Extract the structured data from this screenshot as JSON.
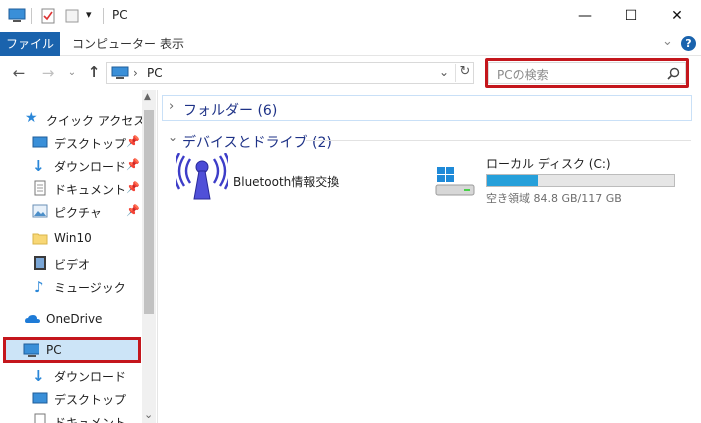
{
  "window": {
    "title": "PC",
    "minimize_glyph": "—",
    "maximize_glyph": "☐",
    "close_glyph": "✕"
  },
  "ribbon": {
    "tabs": [
      "ファイル",
      "コンピューター",
      "表示"
    ],
    "help_glyph": "?",
    "expand_glyph": "⌄"
  },
  "addressbar": {
    "path": "PC",
    "separator": "›"
  },
  "search": {
    "placeholder": "PCの検索"
  },
  "nav": {
    "quick_access": "クイック アクセス",
    "items": [
      {
        "label": "デスクトップ",
        "pinned": true
      },
      {
        "label": "ダウンロード",
        "pinned": true
      },
      {
        "label": "ドキュメント",
        "pinned": true
      },
      {
        "label": "ピクチャ",
        "pinned": true
      },
      {
        "label": "Win10",
        "pinned": false
      },
      {
        "label": "ビデオ",
        "pinned": false
      },
      {
        "label": "ミュージック",
        "pinned": false
      }
    ],
    "onedrive": "OneDrive",
    "pc": "PC",
    "pc_children": [
      "ダウンロード",
      "デスクトップ",
      "ドキュメント"
    ]
  },
  "content": {
    "folders_group": "フォルダー (6)",
    "devices_group": "デバイスとドライブ (2)",
    "bluetooth_label": "Bluetooth情報交換",
    "drive_label": "ローカル ディスク (C:)",
    "drive_free_text": "空き領域 84.8 GB/117 GB",
    "drive_used_fraction": 0.275
  },
  "colors": {
    "accent": "#1a63ad",
    "highlight": "#c4161c",
    "drive_bar": "#26a0da"
  }
}
